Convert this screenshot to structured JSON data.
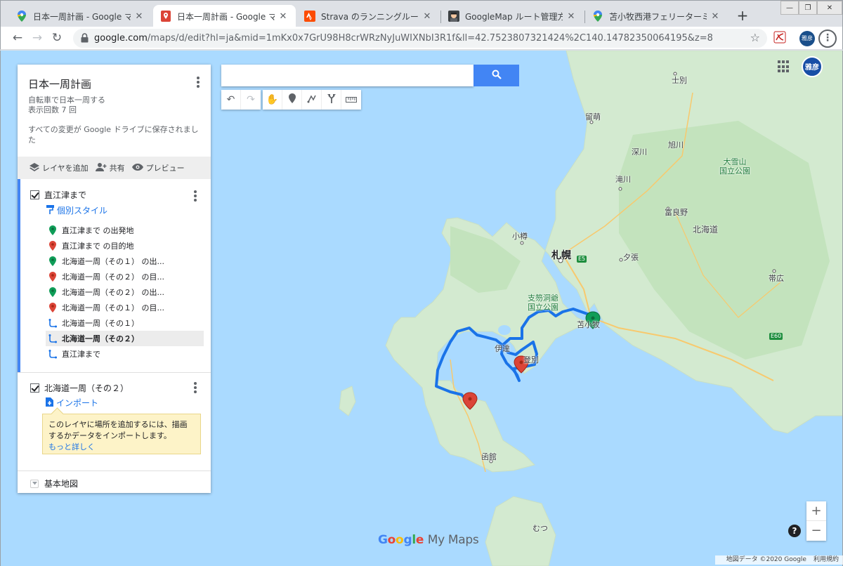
{
  "tabs": [
    {
      "title": "日本一周計画 - Google マップ",
      "favicon": "maps-pin-icon",
      "active": false
    },
    {
      "title": "日本一周計画 - Google マイマ",
      "favicon": "mymaps-pin-icon",
      "active": true
    },
    {
      "title": "Strava のランニングルート、",
      "favicon": "strava-icon",
      "active": false
    },
    {
      "title": "GoogleMap ルート管理方法 -",
      "favicon": "blog-icon",
      "active": false
    },
    {
      "title": "苫小牧西港フェリーターミナル",
      "favicon": "maps-pin-icon",
      "active": false
    }
  ],
  "new_tab": "+",
  "window_controls": [
    "—",
    "❐",
    "✕"
  ],
  "address_bar": {
    "domain": "google.com",
    "path": "/maps/d/edit?hl=ja&mid=1mKx0x7GrU98H8crWRzNyJuWIXNbI3R1f&ll=42.7523807321424%2C140.14782350064195&z=8"
  },
  "profile_chip": "雅彦",
  "panel": {
    "title": "日本一周計画",
    "description_line1": "自転車で日本一周する",
    "description_line2": "表示回数 7 回",
    "saved_message": "すべての変更が Google ドライブに保存されました",
    "actions": {
      "add_layer": "レイヤを追加",
      "share": "共有",
      "preview": "プレビュー"
    },
    "layers": [
      {
        "name": "直江津まで",
        "style_link": "個別スタイル",
        "features": [
          {
            "label": "直江津まで の出発地",
            "icon": "green-pin-icon"
          },
          {
            "label": "直江津まで の目的地",
            "icon": "red-pin-icon"
          },
          {
            "label": "北海道一周（その１） の出...",
            "icon": "green-pin-icon"
          },
          {
            "label": "北海道一周（その２） の目...",
            "icon": "red-pin-icon"
          },
          {
            "label": "北海道一周（その２） の出...",
            "icon": "green-pin-icon"
          },
          {
            "label": "北海道一周（その１） の目...",
            "icon": "red-pin-icon"
          },
          {
            "label": "北海道一周（その１）",
            "icon": "bike-route-icon"
          },
          {
            "label": "北海道一周（その２）",
            "icon": "bike-route-icon"
          },
          {
            "label": "直江津まで",
            "icon": "bike-route-icon"
          }
        ]
      },
      {
        "name": "北海道一周（その２）",
        "import_link": "インポート",
        "tooltip_text": "このレイヤに場所を追加するには、描画するかデータをインポートします。",
        "tooltip_more": "もっと詳しく"
      }
    ],
    "basemap": "基本地図"
  },
  "map_labels": {
    "sapporo": "札幌",
    "otaru": "小樽",
    "rumoi": "留萌",
    "shibetsu": "士別",
    "fukagawa": "深川",
    "asahikawa": "旭川",
    "takikawa": "滝川",
    "furano": "富良野",
    "yubari": "夕張",
    "hokkaido": "北海道",
    "obihiro": "帯広",
    "daisetsuzan": "大雪山\n国立公園",
    "shikotsu": "支笏洞爺\n国立公園",
    "tomakomai": "苫小牧",
    "hakodate": "函館",
    "mutsu": "むつ",
    "date": "伊達",
    "noboribetsu": "登別",
    "e5": "E5",
    "e60": "E60"
  },
  "branding": {
    "google": "Google",
    "mymaps": "My Maps"
  },
  "attribution": {
    "data": "地図データ ©2020 Google",
    "terms": "利用規約"
  },
  "zoom": {
    "in": "+",
    "out": "−"
  },
  "help": "?",
  "map_avatar": "雅彦",
  "colors": {
    "route": "#1a73e8",
    "accent": "#4285f4",
    "green_pin": "#0f9d58",
    "red_pin": "#db4437"
  }
}
